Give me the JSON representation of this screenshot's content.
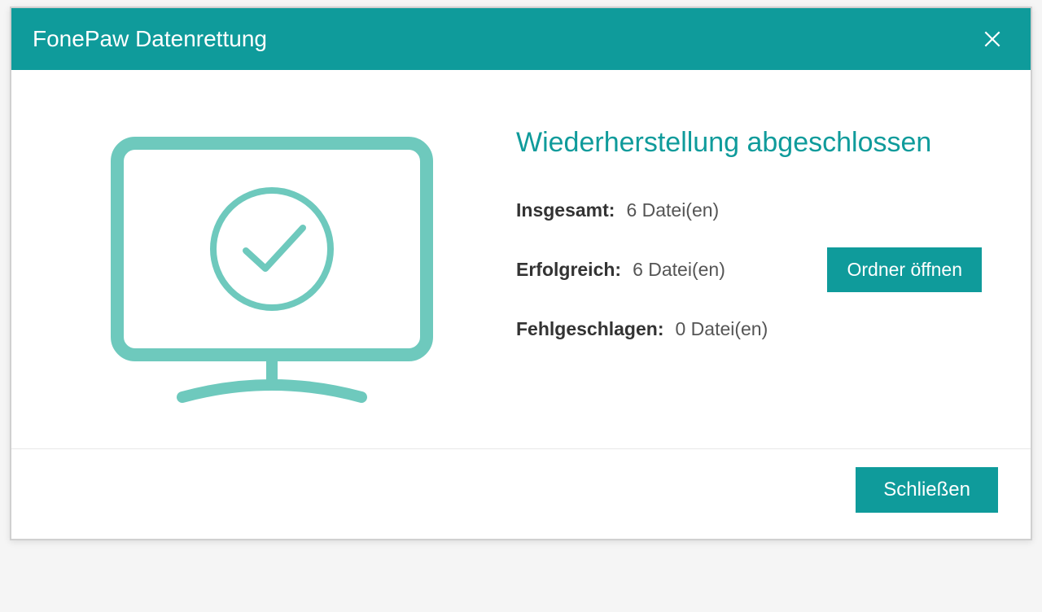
{
  "titlebar": {
    "title": "FonePaw Datenrettung"
  },
  "main": {
    "heading": "Wiederherstellung abgeschlossen",
    "stats": {
      "total_label": "Insgesamt:",
      "total_value": "6 Datei(en)",
      "success_label": "Erfolgreich:",
      "success_value": "6 Datei(en)",
      "failed_label": "Fehlgeschlagen:",
      "failed_value": "0 Datei(en)"
    },
    "open_folder_label": "Ordner öffnen"
  },
  "footer": {
    "close_label": "Schließen"
  },
  "colors": {
    "accent": "#0f9b9b",
    "icon_stroke": "#6ec9bd"
  }
}
